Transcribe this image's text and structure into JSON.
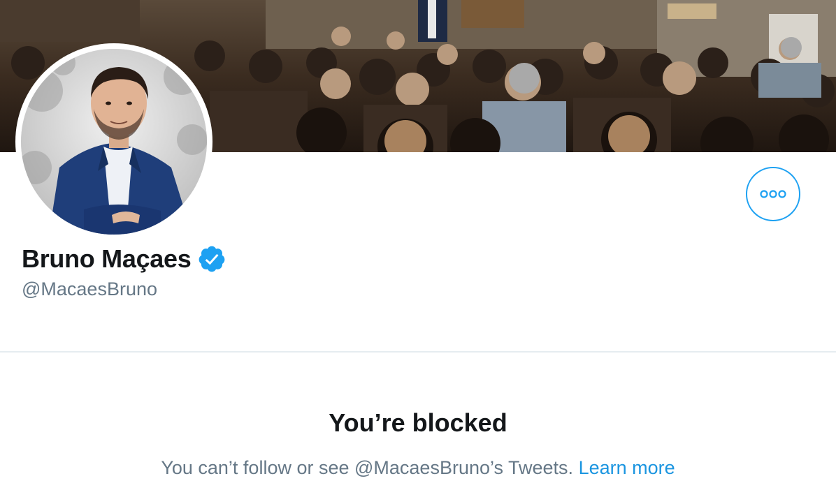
{
  "profile": {
    "display_name": "Bruno Maçaes",
    "handle": "@MacaesBruno",
    "verified": true
  },
  "icons": {
    "verified": "verified-badge-icon",
    "more": "more-options-icon"
  },
  "blocked": {
    "title": "You’re blocked",
    "message": "You can’t follow or see @MacaesBruno’s Tweets.",
    "link_label": "Learn more"
  },
  "colors": {
    "accent": "#1da1f2",
    "link": "#1b95e0",
    "primary_text": "#14171a",
    "secondary_text": "#657786"
  }
}
